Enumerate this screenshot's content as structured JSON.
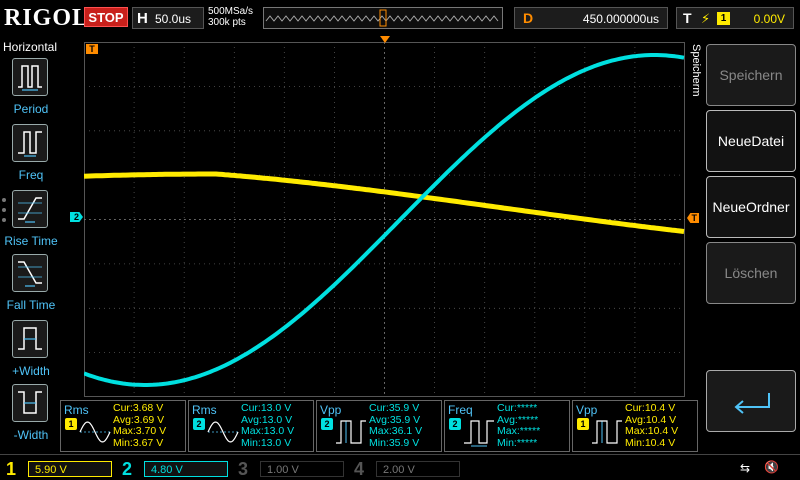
{
  "topbar": {
    "logo": "RIGOL",
    "run_status": "STOP",
    "timebase_label": "H",
    "timebase": "50.0us",
    "sample_rate": "500MSa/s",
    "memory_depth": "300k pts",
    "delay_label": "D",
    "delay": "450.000000us",
    "trigger_label": "T",
    "trigger_source": "1",
    "trigger_level": "0.00V"
  },
  "left_panel": {
    "title": "Horizontal",
    "items": [
      {
        "label": "Period",
        "icon": "period-icon"
      },
      {
        "label": "Freq",
        "icon": "freq-icon"
      },
      {
        "label": "Rise Time",
        "icon": "rise-time-icon"
      },
      {
        "label": "Fall Time",
        "icon": "fall-time-icon"
      },
      {
        "label": "+Width",
        "icon": "positive-width-icon"
      },
      {
        "label": "-Width",
        "icon": "negative-width-icon"
      }
    ]
  },
  "markers": {
    "ch2": "2",
    "trigger_level": "T",
    "trigger_pos": "T"
  },
  "right_panel": {
    "title": "Speicherm",
    "buttons": [
      {
        "label": "Speichern",
        "enabled": false
      },
      {
        "label": "NeueDatei",
        "enabled": true
      },
      {
        "label": "NeueOrdner",
        "enabled": true
      },
      {
        "label": "Löschen",
        "enabled": false
      }
    ]
  },
  "measurements": [
    {
      "type": "Rms",
      "source": "1",
      "cur": "Cur:3.68 V",
      "avg": "Avg:3.69 V",
      "max": "Max:3.70 V",
      "min": "Min:3.67 V"
    },
    {
      "type": "Rms",
      "source": "2",
      "cur": "Cur:13.0 V",
      "avg": "Avg:13.0 V",
      "max": "Max:13.0 V",
      "min": "Min:13.0 V"
    },
    {
      "type": "Vpp",
      "source": "2",
      "cur": "Cur:35.9 V",
      "avg": "Avg:35.9 V",
      "max": "Max:36.1 V",
      "min": "Min:35.9 V"
    },
    {
      "type": "Freq",
      "source": "2",
      "cur": "Cur:*****",
      "avg": "Avg:*****",
      "max": "Max:*****",
      "min": "Min:*****"
    },
    {
      "type": "Vpp",
      "source": "1",
      "cur": "Cur:10.4 V",
      "avg": "Avg:10.4 V",
      "max": "Max:10.4 V",
      "min": "Min:10.4 V"
    }
  ],
  "channels": [
    {
      "num": "1",
      "scale": "5.90 V",
      "color": "#ffeb00",
      "active": true
    },
    {
      "num": "2",
      "scale": "4.80 V",
      "color": "#00e0e0",
      "active": true
    },
    {
      "num": "3",
      "scale": "1.00 V",
      "color": "#c040c0",
      "active": false
    },
    {
      "num": "4",
      "scale": "2.00 V",
      "color": "#4070ff",
      "active": false
    }
  ],
  "colors": {
    "ch1": "#ffeb00",
    "ch2": "#00e0e0",
    "trigger": "#ff8c00",
    "accent_blue": "#4fc3f7",
    "stop": "#c8201b"
  }
}
